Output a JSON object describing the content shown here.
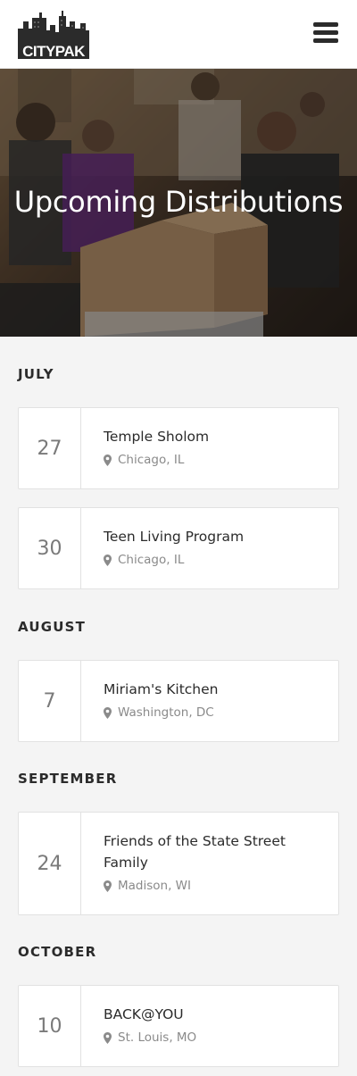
{
  "header": {
    "logo_text": "CITYPAK",
    "menu_icon": "hamburger-menu-icon"
  },
  "hero": {
    "title": "Upcoming Distributions"
  },
  "months": [
    {
      "label": "JULY",
      "events": [
        {
          "day": "27",
          "name": "Temple Sholom",
          "location": "Chicago, IL"
        },
        {
          "day": "30",
          "name": "Teen Living Program",
          "location": "Chicago, IL"
        }
      ]
    },
    {
      "label": "AUGUST",
      "events": [
        {
          "day": "7",
          "name": "Miriam's Kitchen",
          "location": "Washington, DC"
        }
      ]
    },
    {
      "label": "SEPTEMBER",
      "events": [
        {
          "day": "24",
          "name": "Friends of the State Street Family",
          "location": "Madison, WI"
        }
      ]
    },
    {
      "label": "OCTOBER",
      "events": [
        {
          "day": "10",
          "name": "BACK@YOU",
          "location": "St. Louis, MO"
        }
      ]
    }
  ],
  "colors": {
    "text": "#2b2b2b",
    "muted": "#8a8a8a",
    "background": "#f4f4f4",
    "card": "#ffffff"
  }
}
